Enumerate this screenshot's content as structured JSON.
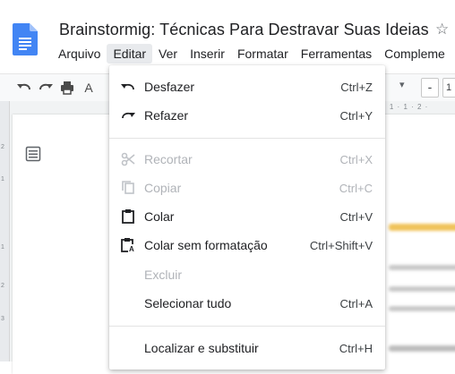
{
  "document": {
    "title": "Brainstormig: Técnicas Para Destravar Suas Ideias",
    "star_icon": "star-outline-icon"
  },
  "menubar": {
    "items": [
      "Arquivo",
      "Editar",
      "Ver",
      "Inserir",
      "Formatar",
      "Ferramentas",
      "Compleme"
    ],
    "active": "Editar"
  },
  "toolbar": {
    "icons": [
      "undo-icon",
      "redo-icon",
      "print-icon",
      "spellcheck-icon"
    ],
    "minus_label": "-",
    "font_size": "1"
  },
  "ruler": {
    "top_ticks": "· 1 · 1 · 2 ·",
    "left_ticks": [
      "2",
      "1",
      "1",
      "2",
      "3"
    ]
  },
  "edit_menu": {
    "items": [
      {
        "icon": "undo-icon",
        "label": "Desfazer",
        "shortcut": "Ctrl+Z",
        "enabled": true
      },
      {
        "icon": "redo-icon",
        "label": "Refazer",
        "shortcut": "Ctrl+Y",
        "enabled": true
      },
      {
        "icon": "scissors-icon",
        "label": "Recortar",
        "shortcut": "Ctrl+X",
        "enabled": false
      },
      {
        "icon": "copy-icon",
        "label": "Copiar",
        "shortcut": "Ctrl+C",
        "enabled": false
      },
      {
        "icon": "clipboard-icon",
        "label": "Colar",
        "shortcut": "Ctrl+V",
        "enabled": true
      },
      {
        "icon": "paste-plain-icon",
        "label": "Colar sem formatação",
        "shortcut": "Ctrl+Shift+V",
        "enabled": true
      },
      {
        "icon": "",
        "label": "Excluir",
        "shortcut": "",
        "enabled": false
      },
      {
        "icon": "",
        "label": "Selecionar tudo",
        "shortcut": "Ctrl+A",
        "enabled": true
      },
      {
        "icon": "",
        "label": "Localizar e substituir",
        "shortcut": "Ctrl+H",
        "enabled": true
      }
    ]
  },
  "colors": {
    "docs_blue": "#4285f4",
    "highlight": "#f6d365",
    "disabled_text": "#b0b3b8"
  }
}
